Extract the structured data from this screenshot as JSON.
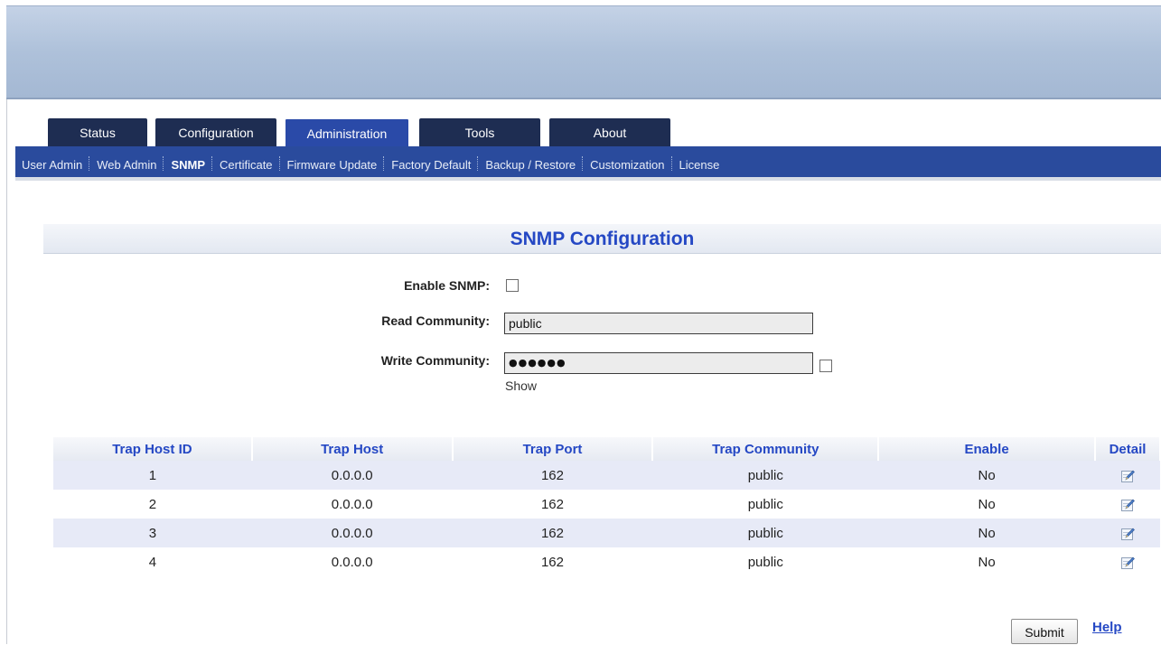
{
  "tabs": [
    {
      "label": "Status"
    },
    {
      "label": "Configuration"
    },
    {
      "label": "Administration",
      "active": true
    },
    {
      "label": "Tools"
    },
    {
      "label": "About"
    }
  ],
  "subnav": [
    {
      "label": "User Admin"
    },
    {
      "label": "Web Admin"
    },
    {
      "label": "SNMP",
      "active": true
    },
    {
      "label": "Certificate"
    },
    {
      "label": "Firmware Update"
    },
    {
      "label": "Factory Default"
    },
    {
      "label": "Backup / Restore"
    },
    {
      "label": "Customization"
    },
    {
      "label": "License"
    }
  ],
  "page": {
    "title": "SNMP Configuration"
  },
  "form": {
    "enable_label": "Enable SNMP:",
    "enable_checked": false,
    "read_label": "Read Community:",
    "read_value": "public",
    "write_label": "Write Community:",
    "write_value": "●●●●●●",
    "show_label": "Show",
    "show_checked": false
  },
  "table": {
    "headers": [
      "Trap Host ID",
      "Trap Host",
      "Trap Port",
      "Trap Community",
      "Enable",
      "Detail"
    ],
    "rows": [
      {
        "id": "1",
        "host": "0.0.0.0",
        "port": "162",
        "community": "public",
        "enable": "No"
      },
      {
        "id": "2",
        "host": "0.0.0.0",
        "port": "162",
        "community": "public",
        "enable": "No"
      },
      {
        "id": "3",
        "host": "0.0.0.0",
        "port": "162",
        "community": "public",
        "enable": "No"
      },
      {
        "id": "4",
        "host": "0.0.0.0",
        "port": "162",
        "community": "public",
        "enable": "No"
      }
    ]
  },
  "actions": {
    "submit_label": "Submit",
    "help_label": "Help"
  },
  "colors": {
    "nav_dark": "#1e2d52",
    "nav_blue": "#2a4b9d",
    "accent_text": "#2548c4",
    "row_stripe": "#e7eaf7"
  },
  "icons": {
    "detail": "edit-icon"
  }
}
